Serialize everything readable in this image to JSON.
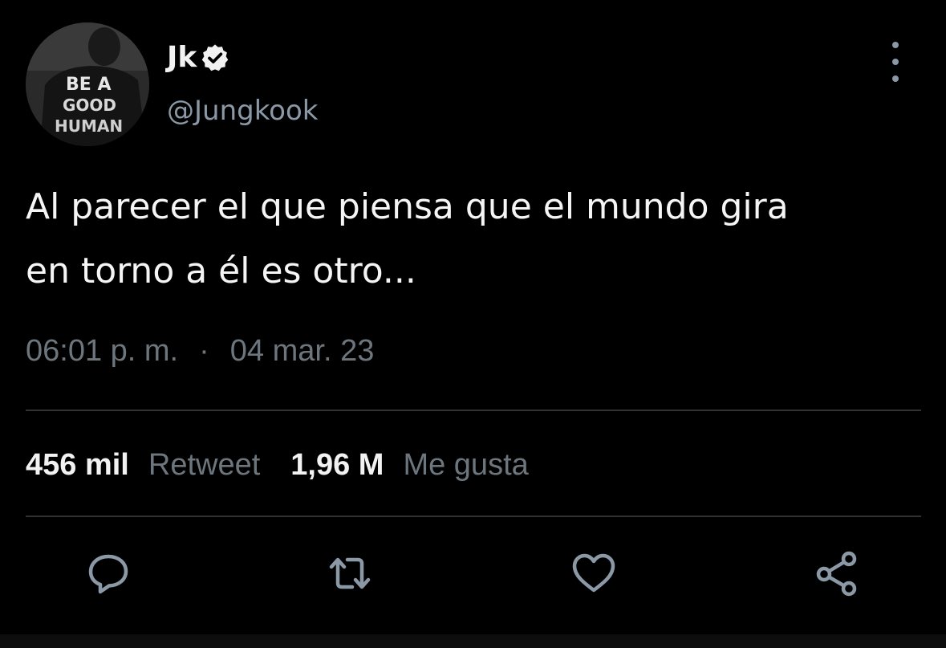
{
  "author": {
    "display_name": "Jk",
    "handle": "@Jungkook",
    "verified": true,
    "avatar_shirt_text": [
      "BE A",
      "GOOD",
      "HUMAN"
    ]
  },
  "tweet": {
    "text": "Al parecer el que piensa que el mundo gira\nen torno a él es otro...",
    "time": "06:01 p. m.",
    "separator": "·",
    "date": "04 mar. 23"
  },
  "stats": {
    "retweets_count": "456 mil",
    "retweets_label": "Retweet",
    "likes_count": "1,96 M",
    "likes_label": "Me gusta"
  },
  "actions": [
    {
      "name": "reply",
      "icon": "reply-icon"
    },
    {
      "name": "retweet",
      "icon": "retweet-icon"
    },
    {
      "name": "like",
      "icon": "heart-icon"
    },
    {
      "name": "share",
      "icon": "share-icon"
    }
  ],
  "colors": {
    "background": "#000000",
    "primary_text": "#f2f2f2",
    "secondary_text": "#6e767d",
    "handle_text": "#8b98a5",
    "divider": "#2f3336",
    "icon": "#8b98a5"
  }
}
